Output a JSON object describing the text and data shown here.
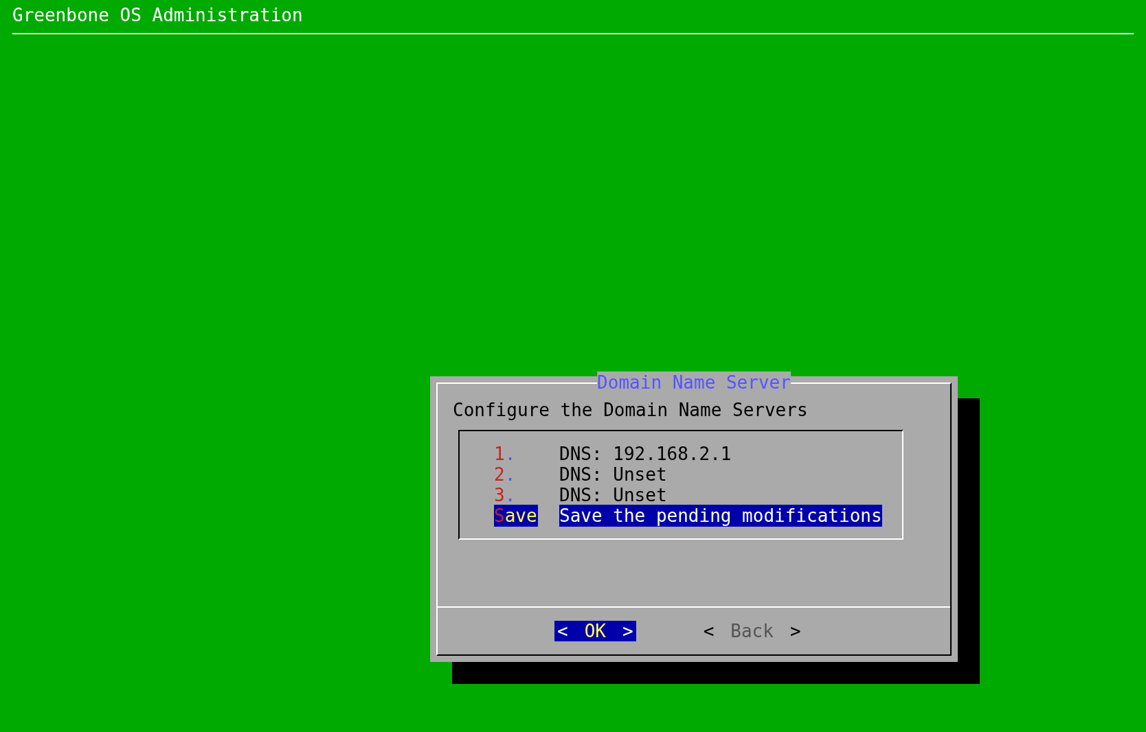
{
  "screen": {
    "title": "Greenbone OS Administration"
  },
  "dialog": {
    "title": "Domain Name Server",
    "prompt": "Configure the Domain Name Servers",
    "items": [
      {
        "tag": "1.",
        "text": "DNS: 192.168.2.1",
        "selected": false
      },
      {
        "tag": "2.",
        "text": "DNS: Unset",
        "selected": false
      },
      {
        "tag": "3.",
        "text": "DNS: Unset",
        "selected": false
      },
      {
        "tag": "Save",
        "text": "Save the pending modifications",
        "selected": true
      }
    ],
    "buttons": [
      {
        "left_mark": "<",
        "label": "OK",
        "right_mark": ">",
        "selected": true
      },
      {
        "left_mark": "<",
        "label": "Back",
        "right_mark": ">",
        "selected": false
      }
    ]
  }
}
